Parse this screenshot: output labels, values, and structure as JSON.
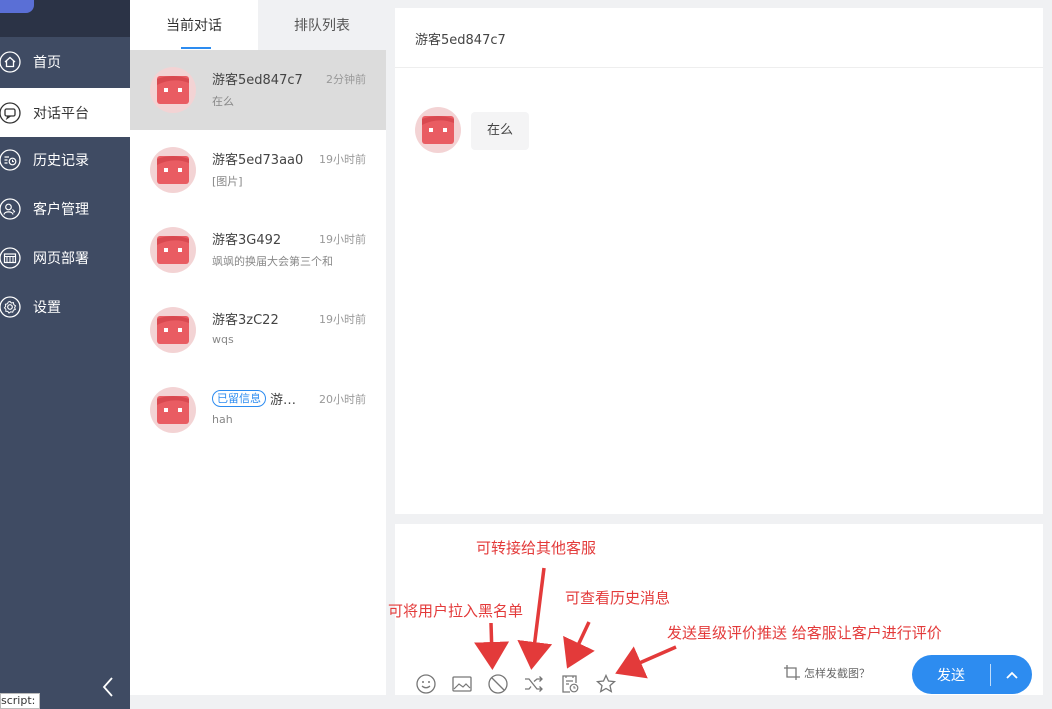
{
  "sidebar": {
    "items": [
      {
        "label": "首页",
        "icon": "home-icon"
      },
      {
        "label": "对话平台",
        "icon": "chat-icon"
      },
      {
        "label": "历史记录",
        "icon": "history-icon"
      },
      {
        "label": "客户管理",
        "icon": "users-icon"
      },
      {
        "label": "网页部署",
        "icon": "web-deploy-icon"
      },
      {
        "label": "设置",
        "icon": "gear-icon"
      }
    ],
    "active_index": 1,
    "collapse_icon": "chevron-left-icon",
    "tooltip": "script:"
  },
  "tabs": [
    {
      "label": "当前对话",
      "active": true
    },
    {
      "label": "排队列表",
      "active": false
    }
  ],
  "conversations": [
    {
      "name": "游客5ed847c7",
      "time": "2分钟前",
      "preview": "在么",
      "selected": true
    },
    {
      "name": "游客5ed73aa0",
      "time": "19小时前",
      "preview": "[图片]"
    },
    {
      "name": "游客3G492",
      "time": "19小时前",
      "preview": "飒飒的换届大会第三个和"
    },
    {
      "name": "游客3zC22",
      "time": "19小时前",
      "preview": "wqs"
    },
    {
      "name": "游…",
      "badge": "已留信息",
      "time": "20小时前",
      "preview": "hah"
    }
  ],
  "chat": {
    "title": "游客5ed847c7",
    "messages": [
      {
        "from": "visitor",
        "text": "在么"
      }
    ]
  },
  "input": {
    "tools": [
      "smile-icon",
      "image-icon",
      "ban-icon",
      "shuffle-icon",
      "history-doc-icon",
      "star-icon"
    ],
    "screenshot_tip": "怎样发截图？",
    "send_label": "发送",
    "send_more_icon": "chevron-up-icon"
  },
  "annotations": {
    "transfer": "可转接给其他客服",
    "blacklist": "可将用户拉入黑名单",
    "history": "可查看历史消息",
    "rating": "发送星级评价推送 给客服让客户进行评价"
  },
  "colors": {
    "sidebar_bg": "#3f4b63",
    "accent": "#2d8cf0",
    "annotation": "#e33a3a",
    "avatar_red": "#e95c62"
  }
}
